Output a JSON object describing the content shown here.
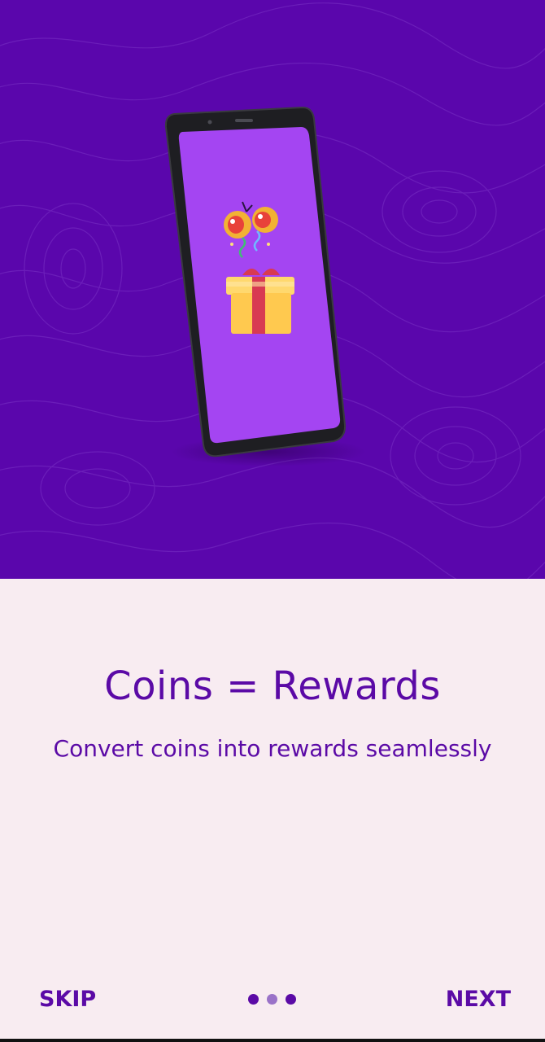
{
  "onboarding": {
    "title": "Coins = Rewards",
    "subtitle": "Convert coins into rewards seamlessly"
  },
  "navigation": {
    "skip_label": "SKIP",
    "next_label": "NEXT",
    "total_pages": 3,
    "current_page": 2
  },
  "colors": {
    "hero_background": "#5a06ac",
    "phone_screen": "#a445f2",
    "content_background": "#f8ecf1",
    "text_primary": "#5b0aa6",
    "dot_active": "#5b0aa6",
    "dot_inactive": "#9a72c8"
  },
  "icons": {
    "illustration": "phone-illustration",
    "confetti": "party-popper-icon",
    "gift": "gift-box-icon"
  }
}
